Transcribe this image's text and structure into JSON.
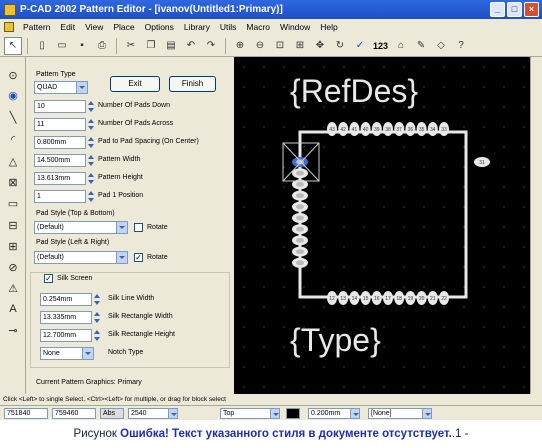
{
  "window": {
    "title": "P-CAD 2002 Pattern Editor - [ivanov(Untitled1:Primary)]"
  },
  "menu": [
    "Pattern",
    "Edit",
    "View",
    "Place",
    "Options",
    "Library",
    "Utils",
    "Macro",
    "Window",
    "Help"
  ],
  "toolbar": {
    "number_tool_label": "123"
  },
  "panel": {
    "pattern_type_label": "Pattern Type",
    "pattern_type_value": "QUAD",
    "exit_label": "Exit",
    "finish_label": "Finish",
    "fields": [
      {
        "value": "10",
        "label": "Number Of Pads Down"
      },
      {
        "value": "11",
        "label": "Number Of Pads Across"
      },
      {
        "value": "0.800mm",
        "label": "Pad to Pad Spacing (On Center)"
      },
      {
        "value": "14.500mm",
        "label": "Pattern Width"
      },
      {
        "value": "13.613mm",
        "label": "Pattern Height"
      },
      {
        "value": "1",
        "label": "Pad 1 Position"
      }
    ],
    "pad_style_tb_label": "Pad Style (Top & Bottom)",
    "pad_style_tb_value": "(Default)",
    "pad_style_lr_label": "Pad Style (Left & Right)",
    "pad_style_lr_value": "(Default)",
    "rotate_label": "Rotate",
    "silk_screen_label": "Silk Screen",
    "silk_fields": [
      {
        "value": "0.254mm",
        "label": "Silk Line Width"
      },
      {
        "value": "13.335mm",
        "label": "Silk Rectangle Width"
      },
      {
        "value": "12.700mm",
        "label": "Silk Rectangle Height"
      }
    ],
    "notch_value": "None",
    "notch_label": "Notch Type",
    "current_graphics_label": "Current Pattern Graphics: Primary"
  },
  "canvas": {
    "refdes_text": "{RefDes}",
    "type_text": "{Type}",
    "top_pad_numbers": [
      "43",
      "42",
      "41",
      "40",
      "39",
      "38",
      "37",
      "36",
      "35",
      "34",
      "33"
    ],
    "bottom_pad_numbers": [
      "12",
      "13",
      "14",
      "15",
      "16",
      "17",
      "18",
      "19",
      "20",
      "21",
      "22"
    ],
    "pin1_label": "1",
    "right_pin_label": "31"
  },
  "status": {
    "hint": "Click <Left> to single Select, <Ctrl><Left> for multiple, or drag for block select",
    "x": "751840",
    "y": "759460",
    "abs_label": "Abs",
    "grid": "2540",
    "layer": "Top",
    "width": "0.200mm",
    "style": "[None]"
  },
  "caption": {
    "prefix": "Рисунок",
    "error": "Ошибка! Текст указанного стиля в документе отсутствует.",
    "suffix": ".1 -"
  },
  "colors": {
    "title_blue": "#2f68e0",
    "canvas_bg": "#000000",
    "pad": "#e8e8e8",
    "pin1_highlight": "#3a6fd8"
  }
}
